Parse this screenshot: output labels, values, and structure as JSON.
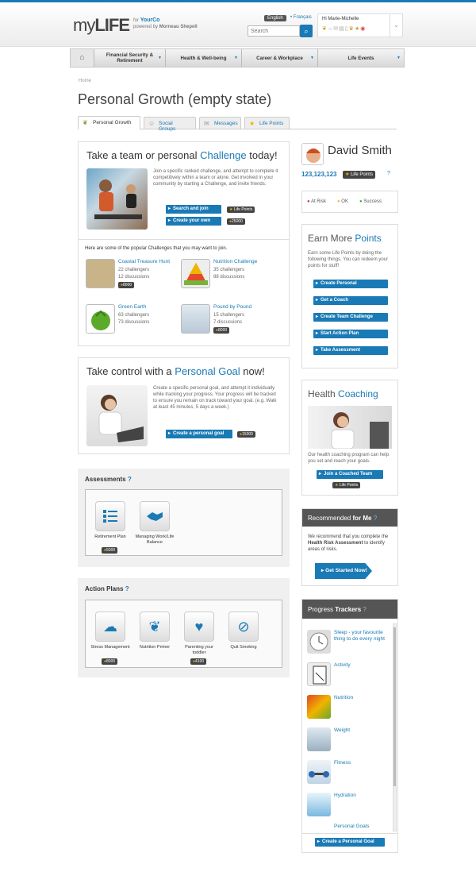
{
  "header": {
    "logo_my": "my",
    "logo_life": "LIFE",
    "for_text": "for",
    "company": "YourCo",
    "powered_by": "powered by",
    "provider": "Morneau Shepell",
    "lang_active": "English",
    "lang_other": "Français",
    "search_placeholder": "Search",
    "greeting": "Hi Marie-Michelle"
  },
  "nav": {
    "items": [
      {
        "label": "Financial Security & Retirement"
      },
      {
        "label": "Health & Well-being"
      },
      {
        "label": "Career & Workplace"
      },
      {
        "label": "Life Events"
      }
    ]
  },
  "breadcrumb": "Home",
  "page_title": "Personal Growth (empty state)",
  "tabs": [
    {
      "label": "Personal Growth"
    },
    {
      "label": "Social Groups"
    },
    {
      "label": "Messages"
    },
    {
      "label": "Life Points"
    }
  ],
  "challenge": {
    "title_pre": "Take a team or personal ",
    "title_link": "Challenge",
    "title_post": " today!",
    "desc": "Join a specific ranked challenge, and attempt to complete it competitively within a team or alone. Get involved in your community by starting a Challenge, and invite friends.",
    "btn_search": "Search and join",
    "badge_search": "Life Points",
    "btn_create": "Create your own",
    "badge_create": "25000",
    "popular_heading": "Here are some of the popular Challenges that you may want to join.",
    "items": [
      {
        "name": "Coastal Treasure Hunt",
        "challengers": "22 challengers",
        "discussions": "12 discussions",
        "points": "8000"
      },
      {
        "name": "Nutrition Challenge",
        "challengers": "35 challengers",
        "discussions": "88 discussions",
        "points": ""
      },
      {
        "name": "Green Earth",
        "challengers": "63 challengers",
        "discussions": "73 discussions",
        "points": ""
      },
      {
        "name": "Pound by Pound",
        "challengers": "15 challengers",
        "discussions": "7 discussions",
        "points": "8000"
      }
    ]
  },
  "goal": {
    "title_pre": "Take control with a ",
    "title_link": "Personal Goal",
    "title_post": " now!",
    "desc": "Create a specific personal goal, and attempt it individually while tracking your progress. Your progress will be tracked to ensure you remain on track toward your goal. (e.g. Walk at least 45 minutes, 5 days a week.)",
    "btn": "Create a personal goal",
    "badge": "15000"
  },
  "assessments": {
    "heading": "Assessments",
    "items": [
      {
        "label": "Retirement Plan",
        "points": "5000"
      },
      {
        "label": "Managing Work/Life Balance",
        "points": ""
      }
    ]
  },
  "action_plans": {
    "heading": "Action Plans",
    "items": [
      {
        "label": "Stress Management",
        "points": "8000"
      },
      {
        "label": "Nutrition Primer",
        "points": ""
      },
      {
        "label": "Parenting your toddler",
        "points": "4100"
      },
      {
        "label": "Quit Smoking",
        "points": ""
      }
    ]
  },
  "profile": {
    "name": "David Smith",
    "points": "123,123,123",
    "points_label": "Life Points",
    "legend": [
      "At Risk",
      "OK",
      "Success"
    ]
  },
  "earn": {
    "title_pre": "Earn More ",
    "title_link": "Points",
    "desc": "Earn some Life Points by doing the following things. You can redeem your points for stuff!",
    "buttons": [
      "Create Personal",
      "Get a Coach",
      "Create Team Challenge",
      "Start Action Plan",
      "Take Assessment"
    ]
  },
  "coaching": {
    "title_pre": "Health ",
    "title_link": "Coaching",
    "desc": "Our health coaching program can help you set and reach your goals.",
    "btn": "Join a Coached Team",
    "badge": "Life Points"
  },
  "recommended": {
    "title_pre": "Recommended ",
    "title_bold": "for Me",
    "desc_pre": "We recommend that you complete the ",
    "desc_bold": "Health Risk Assessment",
    "desc_post": " to identify areas of risks.",
    "btn": "Get Started Now!"
  },
  "trackers": {
    "title_pre": "Progress ",
    "title_bold": "Trackers",
    "items": [
      {
        "label": "Sleep - your favourite thing to do every night"
      },
      {
        "label": "Activity"
      },
      {
        "label": "Nutrition"
      },
      {
        "label": "Weight"
      },
      {
        "label": "Fitness"
      },
      {
        "label": "Hydration"
      },
      {
        "label": "Personal Goals"
      }
    ],
    "btn": "Create a Personal Goal"
  },
  "colors": {
    "accent": "#1a7ab5",
    "dark_header": "#555555"
  }
}
